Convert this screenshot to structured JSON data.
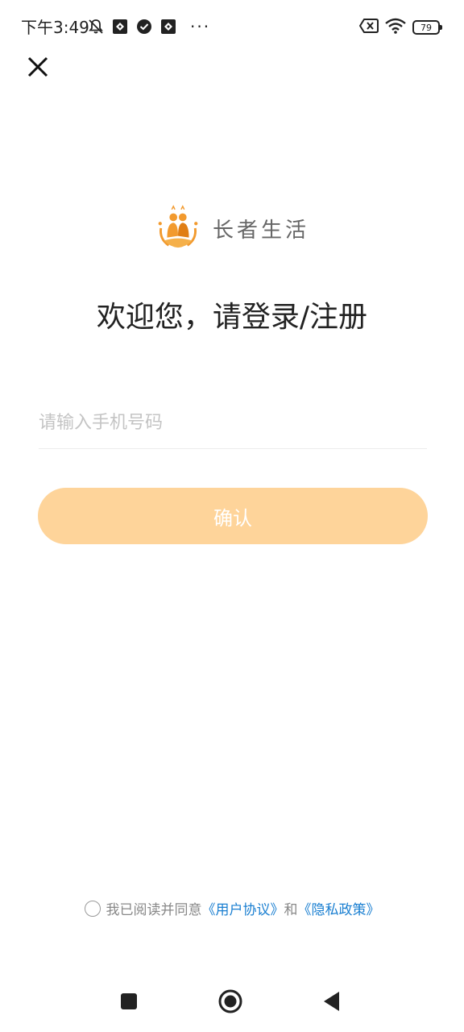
{
  "status_bar": {
    "time": "下午3:49",
    "more": "···",
    "battery": "79",
    "icons": [
      "mute-bell-icon",
      "app-notification-icon",
      "check-circle-icon",
      "app-notification-icon",
      "close-box-icon",
      "wifi-icon",
      "battery-icon"
    ]
  },
  "logo": {
    "text": "长者生活"
  },
  "welcome": "欢迎您，请登录/注册",
  "phone": {
    "placeholder": "请输入手机号码",
    "value": ""
  },
  "confirm_label": "确认",
  "agreement": {
    "prefix": "我已阅读并同意",
    "user_agreement": "《用户协议》",
    "and": "和",
    "privacy_policy": "《隐私政策》"
  },
  "colors": {
    "accent": "#fed49a",
    "link": "#1a7fd1",
    "logo_orange": "#f29a2e"
  }
}
